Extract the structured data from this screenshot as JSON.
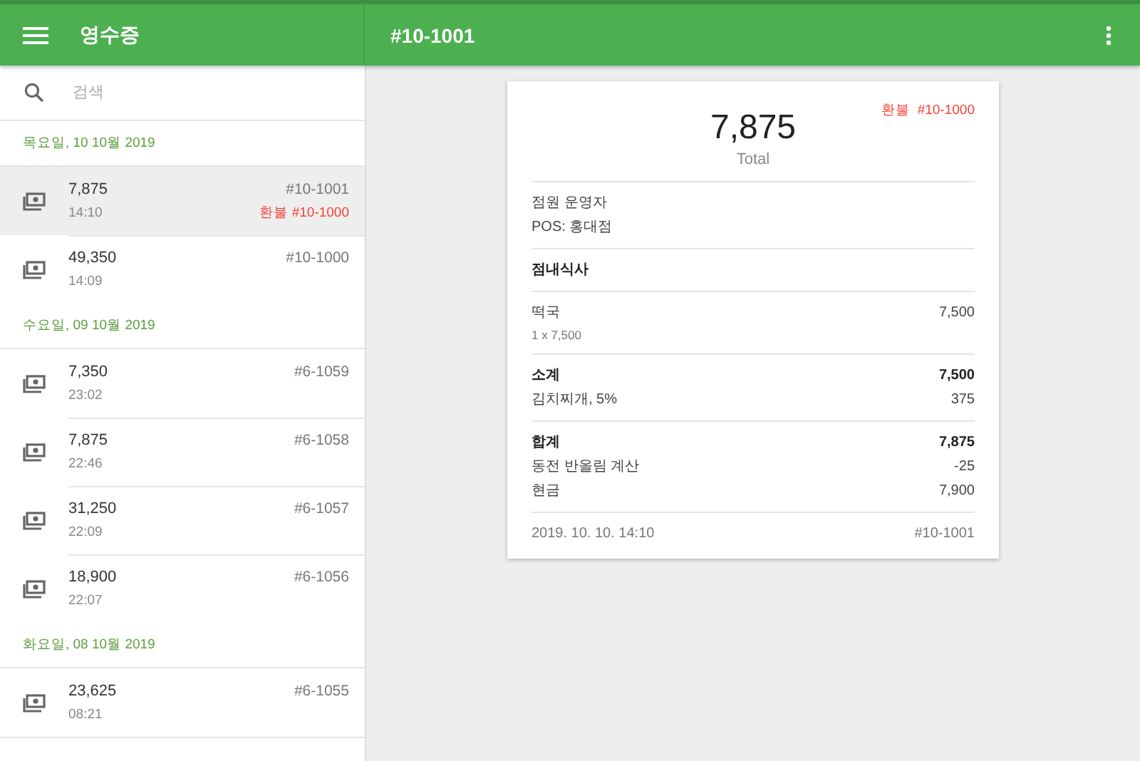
{
  "app_bar": {
    "title": "영수증",
    "detail_title": "#10-1001"
  },
  "search": {
    "placeholder": "검색"
  },
  "groups": [
    {
      "date": "목요일, 10 10월 2019",
      "receipts": [
        {
          "amount": "7,875",
          "time": "14:10",
          "number": "#10-1001",
          "refund": "환불 #10-1000",
          "selected": true
        },
        {
          "amount": "49,350",
          "time": "14:09",
          "number": "#10-1000",
          "selected": false
        }
      ]
    },
    {
      "date": "수요일, 09 10월 2019",
      "receipts": [
        {
          "amount": "7,350",
          "time": "23:02",
          "number": "#6-1059",
          "selected": false
        },
        {
          "amount": "7,875",
          "time": "22:46",
          "number": "#6-1058",
          "selected": false
        },
        {
          "amount": "31,250",
          "time": "22:09",
          "number": "#6-1057",
          "selected": false
        },
        {
          "amount": "18,900",
          "time": "22:07",
          "number": "#6-1056",
          "selected": false
        }
      ]
    },
    {
      "date": "화요일, 08 10월 2019",
      "receipts": [
        {
          "amount": "23,625",
          "time": "08:21",
          "number": "#6-1055",
          "selected": false
        }
      ]
    }
  ],
  "receipt": {
    "refund_label": "환불",
    "refund_number": "#10-1000",
    "total": "7,875",
    "total_label": "Total",
    "sections": [
      {
        "lines": [
          {
            "kind": "text",
            "label": "점원 운영자"
          },
          {
            "kind": "text",
            "label": "POS: 홍대점"
          }
        ]
      },
      {
        "lines": [
          {
            "kind": "bold",
            "label": "점내식사"
          }
        ]
      },
      {
        "lines": [
          {
            "kind": "item",
            "label": "떡국",
            "value": "7,500",
            "sub": "1 x 7,500"
          }
        ]
      },
      {
        "lines": [
          {
            "kind": "bold",
            "label": "소계",
            "value": "7,500"
          },
          {
            "kind": "text",
            "label": "김치찌개, 5%",
            "value": "375"
          }
        ]
      },
      {
        "lines": [
          {
            "kind": "bold",
            "label": "합계",
            "value": "7,875"
          },
          {
            "kind": "text",
            "label": "동전 반올림 계산",
            "value": "-25"
          },
          {
            "kind": "text",
            "label": "현금",
            "value": "7,900"
          }
        ]
      }
    ],
    "footer_date": "2019. 10. 10. 14:10",
    "footer_number": "#10-1001"
  }
}
